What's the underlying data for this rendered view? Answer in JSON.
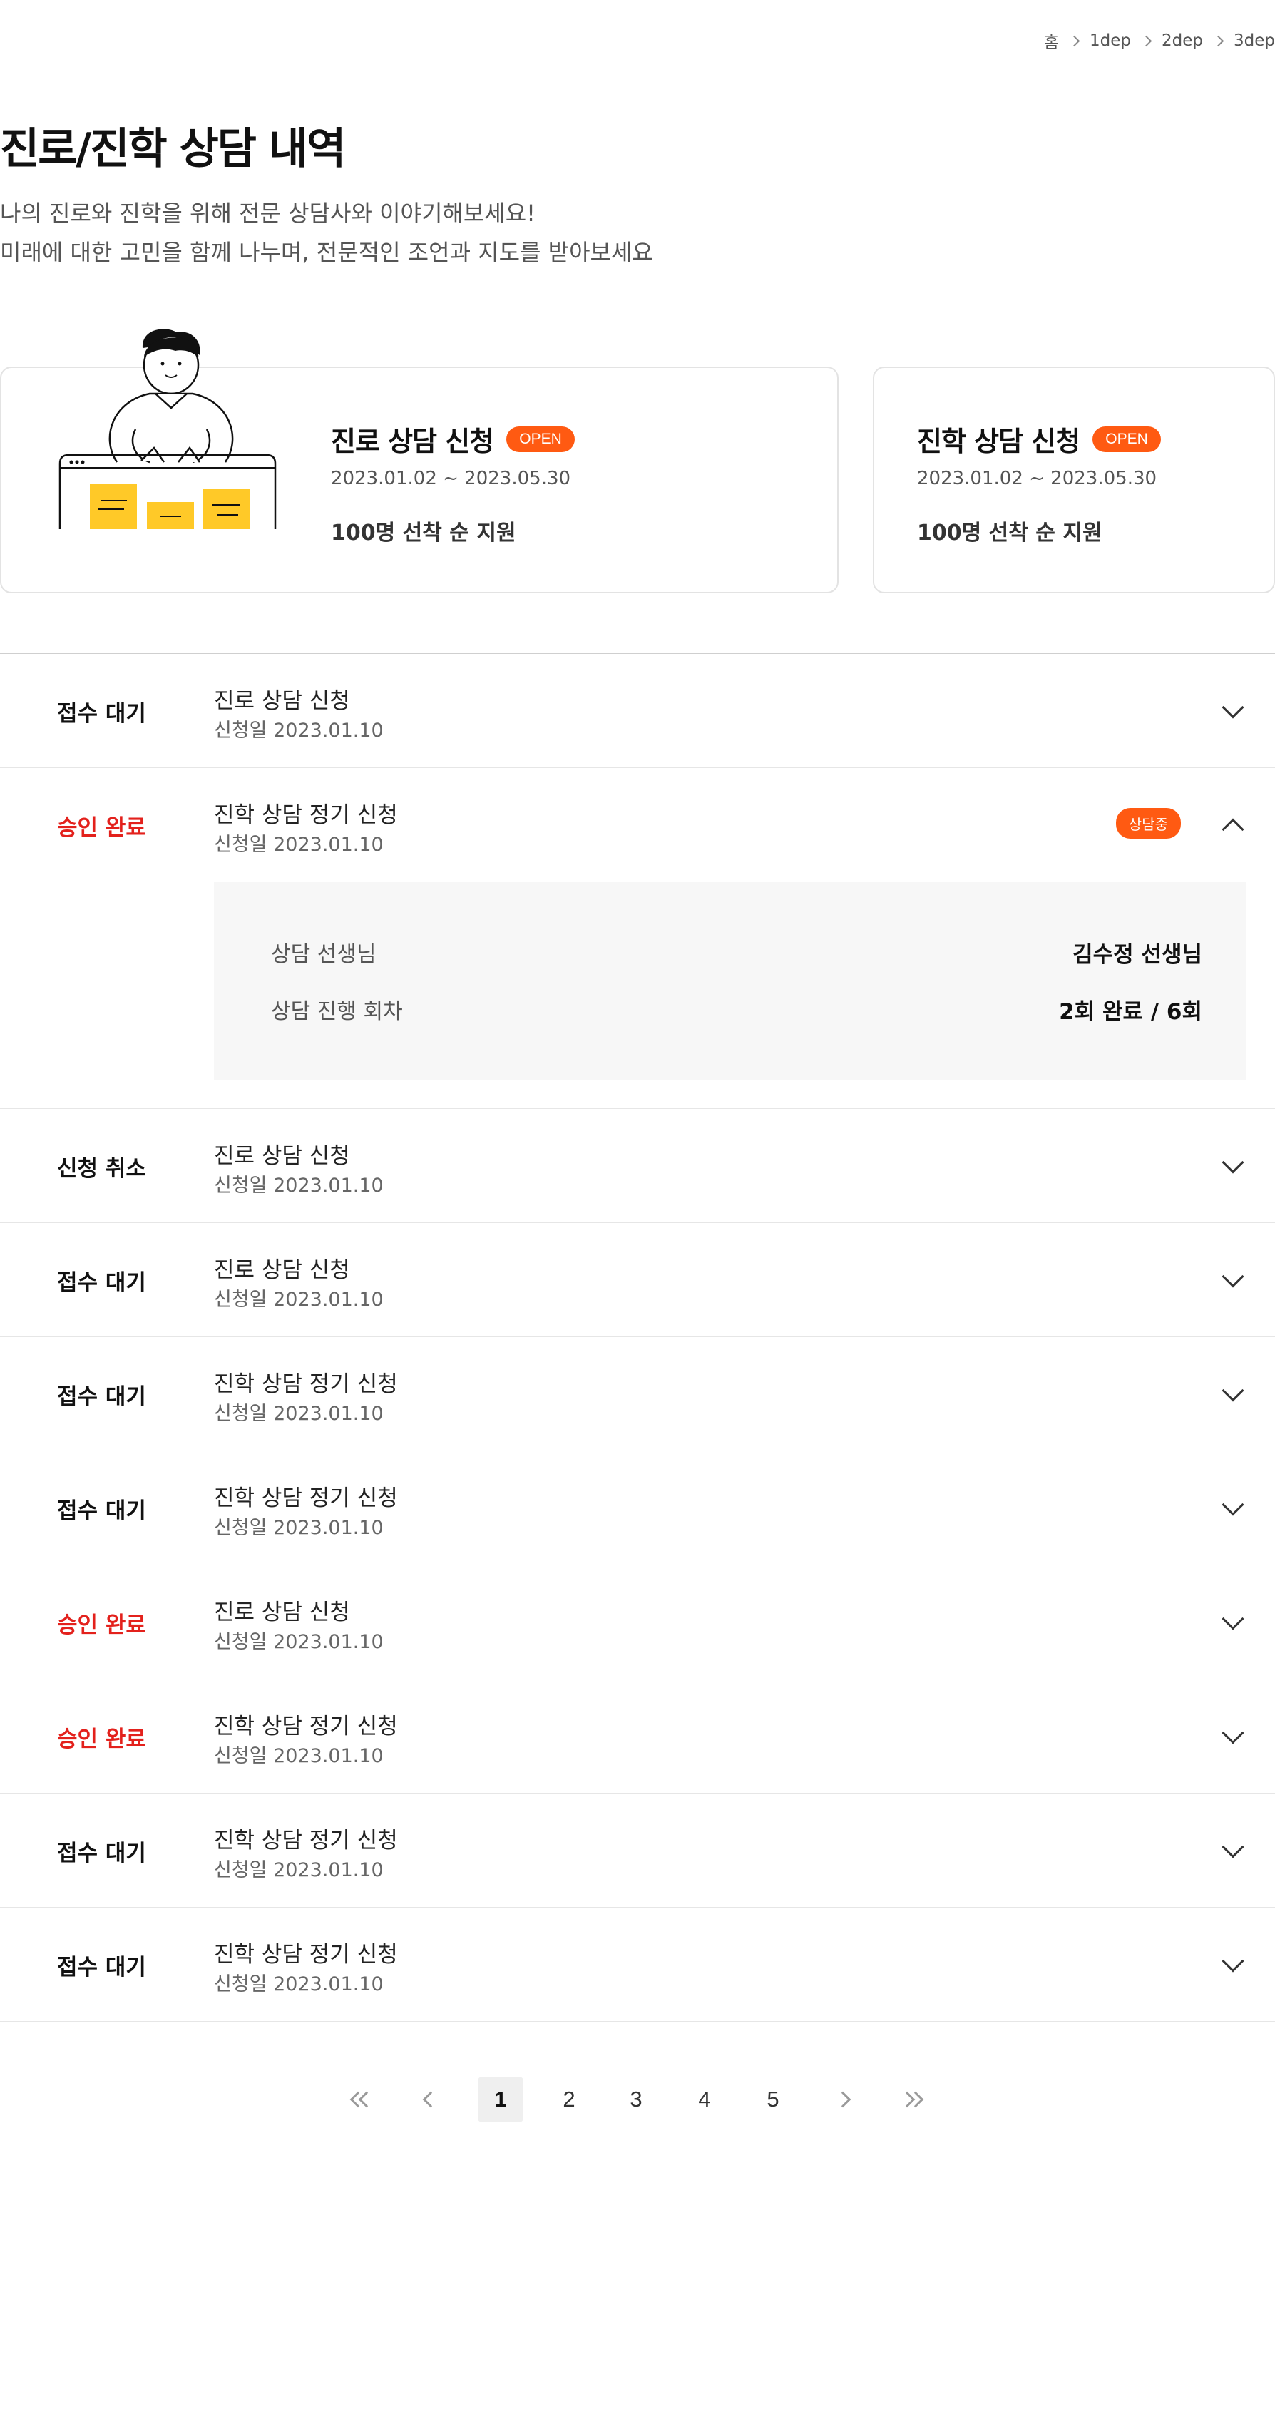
{
  "breadcrumb": [
    "홈",
    "1dep",
    "2dep",
    "3dep"
  ],
  "page": {
    "title": "진로/진학 상담 내역",
    "desc_line1": "나의 진로와 진학을 위해 전문 상담사와 이야기해보세요!",
    "desc_line2": "미래에 대한 고민을 함께 나누며, 전문적인 조언과 지도를 받아보세요"
  },
  "cards": [
    {
      "title": "진로 상담 신청",
      "badge": "OPEN",
      "date": "2023.01.02 ~ 2023.05.30",
      "limit": "100명 선착 순 지원"
    },
    {
      "title": "진학 상담 신청",
      "badge": "OPEN",
      "date": "2023.01.02 ~ 2023.05.30",
      "limit": "100명 선착 순 지원"
    }
  ],
  "rows": [
    {
      "status": "접수 대기",
      "title": "진로 상담 신청",
      "date": "신청일 2023.01.10"
    },
    {
      "status": "승인 완료",
      "title": "진학 상담 정기 신청",
      "date": "신청일 2023.01.10",
      "badge": "상담중"
    },
    {
      "status": "신청 취소",
      "title": "진로 상담 신청",
      "date": "신청일 2023.01.10"
    },
    {
      "status": "접수 대기",
      "title": "진로 상담  신청",
      "date": "신청일 2023.01.10"
    },
    {
      "status": "접수 대기",
      "title": "진학 상담 정기 신청",
      "date": "신청일 2023.01.10"
    },
    {
      "status": "접수 대기",
      "title": "진학 상담 정기 신청",
      "date": "신청일 2023.01.10"
    },
    {
      "status": "승인 완료",
      "title": "진로 상담  신청",
      "date": "신청일 2023.01.10"
    },
    {
      "status": "승인 완료",
      "title": "진학 상담 정기 신청",
      "date": "신청일 2023.01.10"
    },
    {
      "status": "접수 대기",
      "title": "진학 상담 정기 신청",
      "date": "신청일 2023.01.10"
    },
    {
      "status": "접수 대기",
      "title": "진학 상담 정기 신청",
      "date": "신청일 2023.01.10"
    }
  ],
  "detail": {
    "teacher_label": "상담 선생님",
    "teacher_value": "김수정 선생님",
    "count_label": "상담 진행 회차",
    "count_value": "2회 완료 / 6회"
  },
  "pagination": {
    "pages": [
      "1",
      "2",
      "3",
      "4",
      "5"
    ],
    "current": "1"
  },
  "colors": {
    "accent": "#ff5a12",
    "status_red": "#e3211c",
    "card_yellow": "#ffc928"
  }
}
